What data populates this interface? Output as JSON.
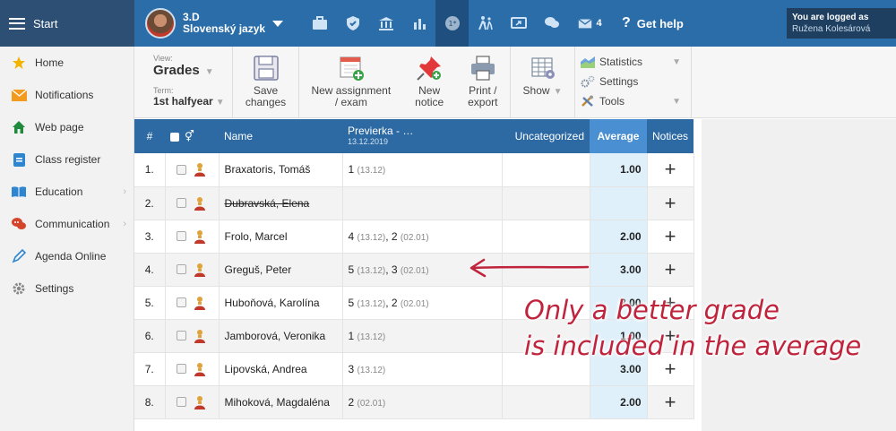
{
  "topbar": {
    "start_label": "Start",
    "class_code": "3.D",
    "subject": "Slovenský jazyk",
    "messages_count": "4",
    "help_label": "Get help",
    "logged_label": "You are logged as",
    "user_name": "Ružena Kolesárová"
  },
  "sidebar": {
    "items": [
      {
        "label": "Home",
        "icon": "star-icon"
      },
      {
        "label": "Notifications",
        "icon": "envelope-icon"
      },
      {
        "label": "Web page",
        "icon": "house-icon"
      },
      {
        "label": "Class register",
        "icon": "register-icon"
      },
      {
        "label": "Education",
        "icon": "book-icon"
      },
      {
        "label": "Communication",
        "icon": "chat-icon"
      },
      {
        "label": "Agenda Online",
        "icon": "pen-icon"
      },
      {
        "label": "Settings",
        "icon": "gear-icon"
      }
    ]
  },
  "toolbar": {
    "view_label": "View:",
    "view_value": "Grades",
    "term_label": "Term:",
    "term_value": "1st halfyear",
    "save_label_1": "Save",
    "save_label_2": "changes",
    "new_assignment_1": "New assignment",
    "new_assignment_2": "/ exam",
    "new_notice_1": "New",
    "new_notice_2": "notice",
    "print_1": "Print /",
    "print_2": "export",
    "show_label": "Show",
    "statistics_label": "Statistics",
    "settings_label": "Settings",
    "tools_label": "Tools"
  },
  "table": {
    "headers": {
      "num": "#",
      "name": "Name",
      "prev_title": "Previerka - …",
      "prev_date": "13.12.2019",
      "uncategorized": "Uncategorized",
      "average": "Average",
      "notices": "Notices"
    },
    "rows": [
      {
        "n": "1.",
        "name": "Braxatoris, Tomáš",
        "g1": "1",
        "d1": "(13.12)",
        "g2": "",
        "d2": "",
        "avg": "1.00",
        "struck": false
      },
      {
        "n": "2.",
        "name": "Dubravská, Elena",
        "g1": "",
        "d1": "",
        "g2": "",
        "d2": "",
        "avg": "",
        "struck": true
      },
      {
        "n": "3.",
        "name": "Frolo, Marcel",
        "g1": "4",
        "d1": "(13.12)",
        "g2": "2",
        "d2": "(02.01)",
        "avg": "2.00",
        "struck": false
      },
      {
        "n": "4.",
        "name": "Greguš, Peter",
        "g1": "5",
        "d1": "(13.12)",
        "g2": "3",
        "d2": "(02.01)",
        "avg": "3.00",
        "struck": false
      },
      {
        "n": "5.",
        "name": "Huboňová, Karolína",
        "g1": "5",
        "d1": "(13.12)",
        "g2": "2",
        "d2": "(02.01)",
        "avg": "2.00",
        "struck": false
      },
      {
        "n": "6.",
        "name": "Jamborová, Veronika",
        "g1": "1",
        "d1": "(13.12)",
        "g2": "",
        "d2": "",
        "avg": "1.00",
        "struck": false
      },
      {
        "n": "7.",
        "name": "Lipovská, Andrea",
        "g1": "3",
        "d1": "(13.12)",
        "g2": "",
        "d2": "",
        "avg": "3.00",
        "struck": false
      },
      {
        "n": "8.",
        "name": "Mihoková, Magdaléna",
        "g1": "2",
        "d1": "(02.01)",
        "g2": "",
        "d2": "",
        "avg": "2.00",
        "struck": false
      }
    ],
    "plus_label": "+"
  },
  "annotation": {
    "line1": "Only a better grade",
    "line2": "is included in the average",
    "color": "#c0243c"
  }
}
